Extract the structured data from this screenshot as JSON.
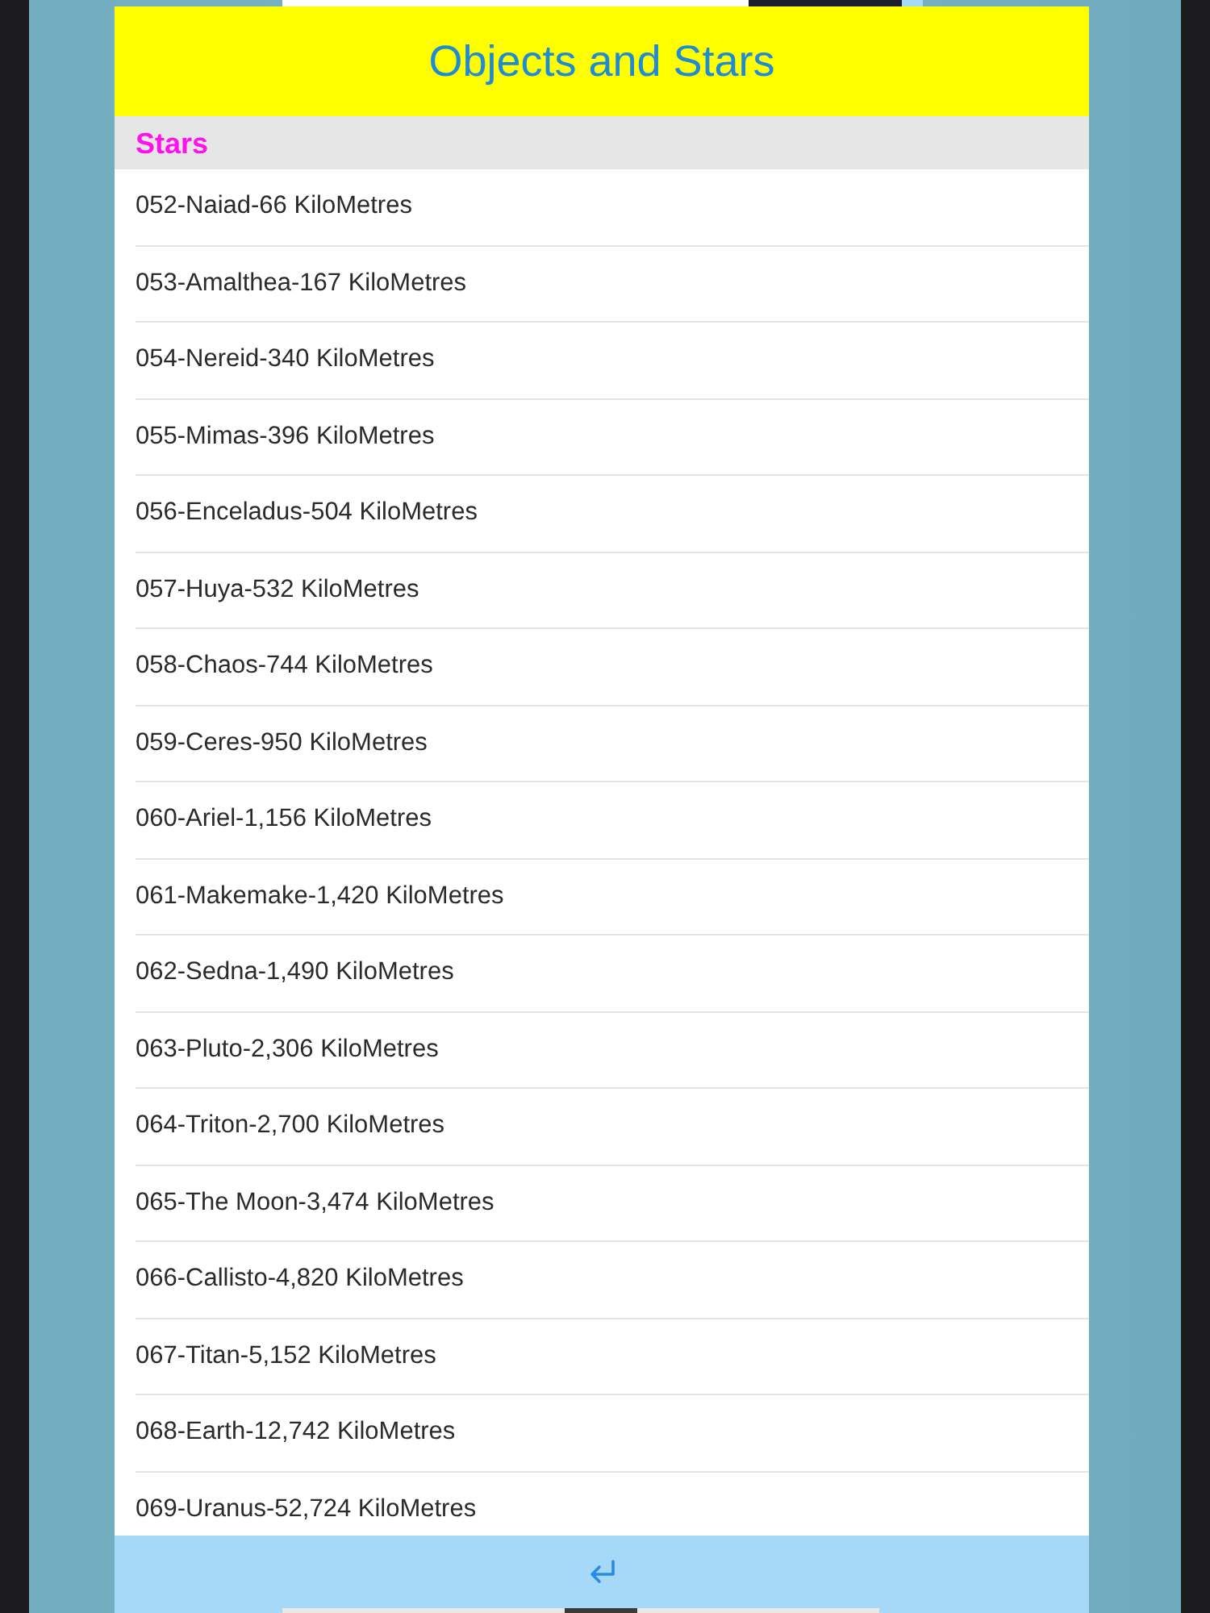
{
  "header": {
    "title": "Objects and Stars"
  },
  "section": {
    "title": "Stars"
  },
  "items": [
    "052-Naiad-66 KiloMetres",
    "053-Amalthea-167 KiloMetres",
    "054-Nereid-340 KiloMetres",
    "055-Mimas-396 KiloMetres",
    "056-Enceladus-504 KiloMetres",
    "057-Huya-532 KiloMetres",
    "058-Chaos-744 KiloMetres",
    "059-Ceres-950 KiloMetres",
    "060-Ariel-1,156 KiloMetres",
    "061-Makemake-1,420 KiloMetres",
    "062-Sedna-1,490 KiloMetres",
    "063-Pluto-2,306 KiloMetres",
    "064-Triton-2,700 KiloMetres",
    "065-The Moon-3,474 KiloMetres",
    "066-Callisto-4,820 KiloMetres",
    "067-Titan-5,152 KiloMetres",
    "068-Earth-12,742 KiloMetres",
    "069-Uranus-52,724 KiloMetres"
  ]
}
